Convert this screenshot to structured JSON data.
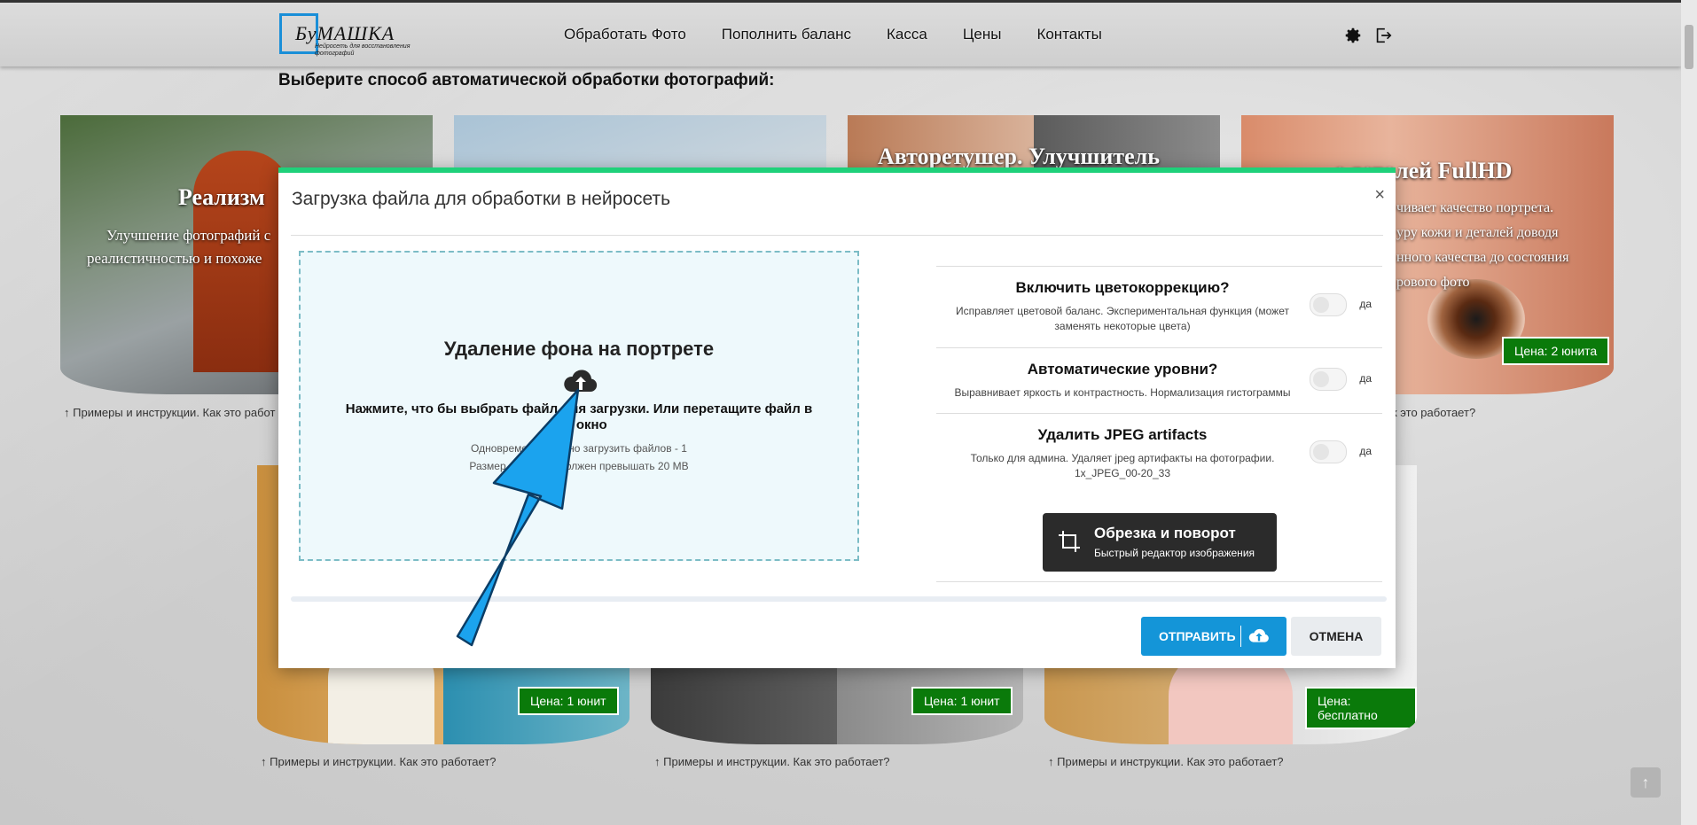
{
  "header": {
    "logo_name": "БуМАШКА",
    "logo_tagline": "Нейросеть для восстановления фотографий",
    "nav": [
      "Обработать Фото",
      "Пополнить баланс",
      "Касса",
      "Цены",
      "Контакты"
    ],
    "icons": [
      "gear-icon",
      "logout-icon"
    ]
  },
  "page": {
    "title": "Выберите способ автоматической обработки фотографий:"
  },
  "cards": {
    "c1_caption": "Реализм",
    "c1_desc1": "Улучшение фотографий с",
    "c1_desc2": "реалистичностью и похоже",
    "c3_caption": "Авторетушер. Улучшитель",
    "c4_caption": "е деталей FullHD",
    "c4_desc1": "чивает качество портрета.",
    "c4_desc2": "уру кожи и деталей доводя",
    "c4_desc3": "нного качества до состояния",
    "c4_desc4": "рового фото",
    "c4_price": "Цена: 2 юнита",
    "examples_full": "Примеры и инструкции. Как это работает?",
    "examples_left": "Примеры и инструкции. Как это работ",
    "examples_right": "к это работает?",
    "c5_price": "Цена: 1 юнит",
    "c6_price": "Цена: 1 юнит",
    "c7_price": "Цена: бесплатно"
  },
  "modal": {
    "title": "Загрузка файла для обработки в нейросеть",
    "close": "×",
    "drop": {
      "title": "Удаление фона на портрете",
      "hint": "Нажмите, что бы выбрать файл для загрузки. Или перетащите файл в это окно",
      "limit": "Одновременно можно загрузить файлов - 1",
      "size": "Размер файла не должен превышать 20 MB"
    },
    "options": [
      {
        "title": "Включить цветокоррекцию?",
        "desc": "Исправляет цветовой баланс. Экспериментальная функция (может заменять некоторые цвета)",
        "toggle_label": "да"
      },
      {
        "title": "Автоматические уровни?",
        "desc": "Выравнивает яркость и контрастность. Нормализация гистограммы",
        "toggle_label": "да"
      },
      {
        "title": "Удалить JPEG artifacts",
        "desc": "Только для админа. Удаляет jpeg артифакты на фотографии. 1x_JPEG_00-20_33",
        "toggle_label": "да"
      }
    ],
    "crop": {
      "title": "Обрезка и поворот",
      "subtitle": "Быстрый редактор изображения"
    },
    "submit_label": "ОТПРАВИТЬ",
    "cancel_label": "ОТМЕНА"
  },
  "colors": {
    "accent": "#1495d8",
    "modal_top_border": "#1fd17a",
    "price_bg": "#0a7a0a",
    "pointer_arrow": "#1ba3ee"
  }
}
